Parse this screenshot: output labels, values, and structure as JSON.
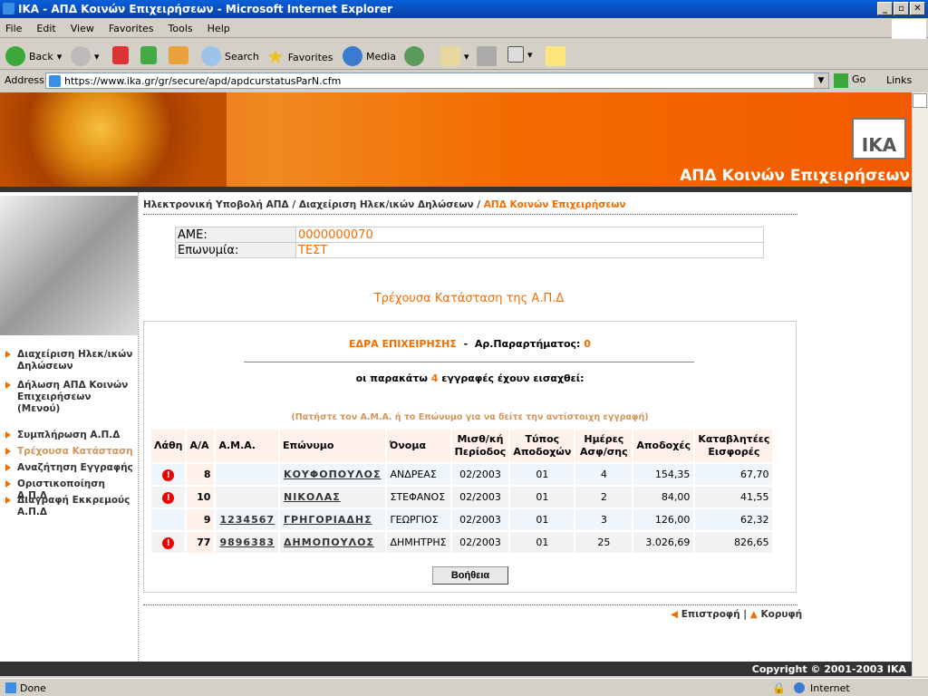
{
  "window": {
    "title": "ΙΚΑ - ΑΠΔ Κοινών Επιχειρήσεων - Microsoft Internet Explorer"
  },
  "menu": [
    "File",
    "Edit",
    "View",
    "Favorites",
    "Tools",
    "Help"
  ],
  "toolbar": {
    "back": "Back",
    "search": "Search",
    "favorites": "Favorites",
    "media": "Media"
  },
  "address": {
    "label": "Address",
    "url": "https://www.ika.gr/gr/secure/apd/apdcurstatusParN.cfm",
    "go": "Go",
    "links": "Links"
  },
  "banner": {
    "logo": "IKA",
    "title": "ΑΠΔ Κοινών Επιχειρήσεων"
  },
  "sidebar": {
    "items": [
      {
        "label": "Διαχείριση Ηλεκ/ικών Δηλώσεων"
      },
      {
        "label": "Δήλωση ΑΠΔ Κοινών Επιχειρήσεων (Μενού)"
      },
      {
        "label": "Συμπλήρωση Α.Π.Δ"
      },
      {
        "label": "Τρέχουσα Κατάσταση",
        "active": true
      },
      {
        "label": "Αναζήτηση Εγγραφής"
      },
      {
        "label": "Οριστικοποίηση Α.Π.Δ"
      },
      {
        "label": "Διαγραφή Εκκρεμούς Α.Π.Δ"
      }
    ]
  },
  "breadcrumb": {
    "p1": "Ηλεκτρονική Υποβολή ΑΠΔ",
    "p2": "Διαχείριση Ηλεκ/ικών Δηλώσεων",
    "current": "ΑΠΔ Κοινών Επιχειρήσεων",
    "sep": "/"
  },
  "employer": {
    "ame_label": "ΑΜΕ:",
    "ame": "0000000070",
    "name_label": "Επωνυμία:",
    "name": "ΤΕΣΤ"
  },
  "heading": "Τρέχουσα Κατάσταση της Α.Π.Δ",
  "summary": {
    "edra": "ΕΔΡΑ ΕΠΙΧΕΙΡΗΣΗΣ",
    "dash": "-",
    "branch_label": "Αρ.Παραρτήματος:",
    "branch": "0",
    "count_pre": "οι παρακάτω",
    "count": "4",
    "count_post": "εγγραφές έχουν εισαχθεί:",
    "hint": "(Πατήστε τον Α.Μ.Α. ή το Επώνυμο για να δείτε την αντίστοιχη εγγραφή)"
  },
  "table": {
    "headers": [
      "Λάθη",
      "Α/Α",
      "Α.Μ.Α.",
      "Επώνυμο",
      "Όνομα",
      "Μισθ/κή Περίοδος",
      "Τύπος Αποδοχών",
      "Ημέρες Ασφ/σης",
      "Αποδοχές",
      "Καταβλητέες Εισφορές"
    ],
    "rows": [
      {
        "error": true,
        "aa": "8",
        "ama": "",
        "surname": "ΚΟΥΦΟΠΟΥΛΟΣ",
        "name": "ΑΝΔΡΕΑΣ",
        "period": "02/2003",
        "type": "01",
        "days": "4",
        "earnings": "154,35",
        "contrib": "67,70"
      },
      {
        "error": true,
        "aa": "10",
        "ama": "",
        "surname": "ΝΙΚΟΛΑΣ",
        "name": "ΣΤΕΦΑΝΟΣ",
        "period": "02/2003",
        "type": "01",
        "days": "2",
        "earnings": "84,00",
        "contrib": "41,55"
      },
      {
        "error": false,
        "aa": "9",
        "ama": "1234567",
        "surname": "ΓΡΗΓΟΡΙΑΔΗΣ",
        "name": "ΓΕΩΡΓΙΟΣ",
        "period": "02/2003",
        "type": "01",
        "days": "3",
        "earnings": "126,00",
        "contrib": "62,32"
      },
      {
        "error": true,
        "aa": "77",
        "ama": "9896383",
        "surname": "ΔΗΜΟΠΟΥΛΟΣ",
        "name": "ΔΗΜΗΤΡΗΣ",
        "period": "02/2003",
        "type": "01",
        "days": "25",
        "earnings": "3.026,69",
        "contrib": "826,65"
      }
    ]
  },
  "help_button": "Βοήθεια",
  "bottom_nav": {
    "back": "Επιστροφή",
    "sep": "|",
    "top": "Κορυφή"
  },
  "footer": "Copyright © 2001-2003 ΙΚΑ",
  "status": {
    "text": "Done",
    "zone": "Internet"
  },
  "colors": {
    "accent": "#f36c00",
    "hint": "#d2955a"
  }
}
